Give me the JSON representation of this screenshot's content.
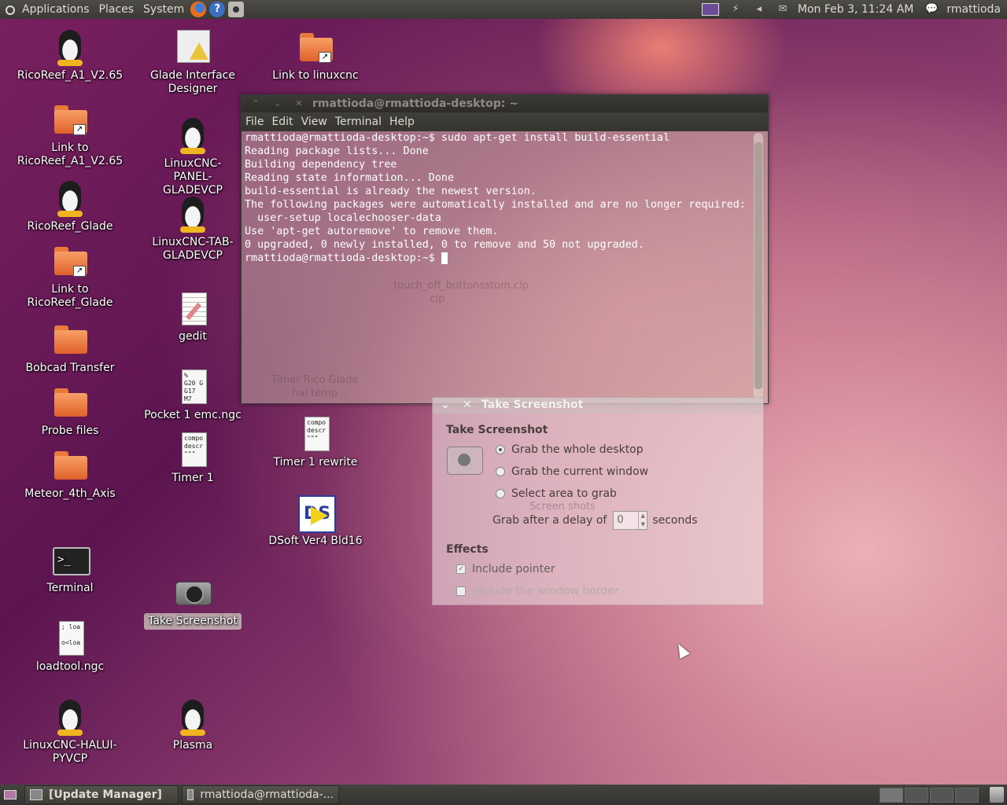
{
  "top_panel": {
    "menus": [
      "Applications",
      "Places",
      "System"
    ],
    "help_glyph": "?",
    "clock": "Mon Feb  3, 11:24 AM",
    "username": "rmattioda",
    "tray_icons": [
      "display-icon",
      "network-icon",
      "volume-icon",
      "mail-icon",
      "user-status-icon"
    ]
  },
  "desktop_icons": {
    "col1": [
      {
        "label": "RicoReef_A1_V2.65",
        "icon": "tux-icon"
      },
      {
        "label": "Link to RicoReef_A1_V2.65",
        "icon": "folder-link-icon"
      },
      {
        "label": "RicoReef_Glade",
        "icon": "tux-icon"
      },
      {
        "label": "Link to RicoReef_Glade",
        "icon": "folder-link-icon"
      },
      {
        "label": "Bobcad Transfer",
        "icon": "folder-icon"
      },
      {
        "label": "Probe files",
        "icon": "folder-icon"
      },
      {
        "label": "Meteor_4th_Axis",
        "icon": "folder-icon"
      },
      {
        "label": "Terminal",
        "icon": "terminal-icon"
      },
      {
        "label": "loadtool.ngc",
        "icon": "document-icon",
        "preview": "; loa\n\no<loa"
      },
      {
        "label": "LinuxCNC-HALUI-PYVCP",
        "icon": "tux-icon"
      }
    ],
    "col2": [
      {
        "label": "Glade Interface Designer",
        "icon": "glade-icon"
      },
      {
        "label": "LinuxCNC-PANEL-GLADEVCP",
        "icon": "tux-icon"
      },
      {
        "label": "LinuxCNC-TAB-GLADEVCP",
        "icon": "tux-icon"
      },
      {
        "label": "gedit",
        "icon": "gedit-icon"
      },
      {
        "label": "Pocket 1 emc.ngc",
        "icon": "document-icon",
        "preview": "%\nG20 G\nG17\nM7"
      },
      {
        "label": "Timer 1",
        "icon": "document-icon",
        "preview": "compo\ndescr\n\"\"\""
      },
      {
        "label": "Take Screenshot",
        "icon": "camera-icon"
      },
      {
        "label": "Plasma",
        "icon": "tux-icon"
      }
    ],
    "col3": [
      {
        "label": "Link to linuxcnc",
        "icon": "folder-link-icon"
      },
      {
        "label": "Timer 1 rewrite",
        "icon": "document-icon",
        "preview": "compo\ndescr\n\"\"\""
      },
      {
        "label": "DSoft Ver4 Bld16",
        "icon": "dsoft-icon"
      }
    ],
    "ghost_labels": [
      "touch_off_buttonsstom.clp",
      "clp",
      "Timer Rico Glade",
      "hal temp",
      "Screen shots"
    ]
  },
  "terminal_window": {
    "title": "rmattioda@rmattioda-desktop: ~",
    "menu": [
      "File",
      "Edit",
      "View",
      "Terminal",
      "Help"
    ],
    "lines": [
      "rmattioda@rmattioda-desktop:~$ sudo apt-get install build-essential",
      "Reading package lists... Done",
      "Building dependency tree",
      "Reading state information... Done",
      "build-essential is already the newest version.",
      "The following packages were automatically installed and are no longer required:",
      "  user-setup localechooser-data",
      "Use 'apt-get autoremove' to remove them.",
      "0 upgraded, 0 newly installed, 0 to remove and 50 not upgraded."
    ],
    "prompt": "rmattioda@rmattioda-desktop:~$ "
  },
  "screenshot_dialog": {
    "title": "Take Screenshot",
    "heading": "Take Screenshot",
    "options": [
      {
        "label": "Grab the whole desktop",
        "selected": true
      },
      {
        "label": "Grab the current window",
        "selected": false
      },
      {
        "label": "Select area to grab",
        "selected": false
      }
    ],
    "delay_prefix": "Grab after a delay of",
    "delay_value": "0",
    "delay_suffix": "seconds",
    "effects_heading": "Effects",
    "include_pointer": "Include pointer",
    "include_border": "Include the window border"
  },
  "bottom_panel": {
    "tasks": [
      "[Update Manager]",
      "rmattioda@rmattioda-..."
    ]
  }
}
